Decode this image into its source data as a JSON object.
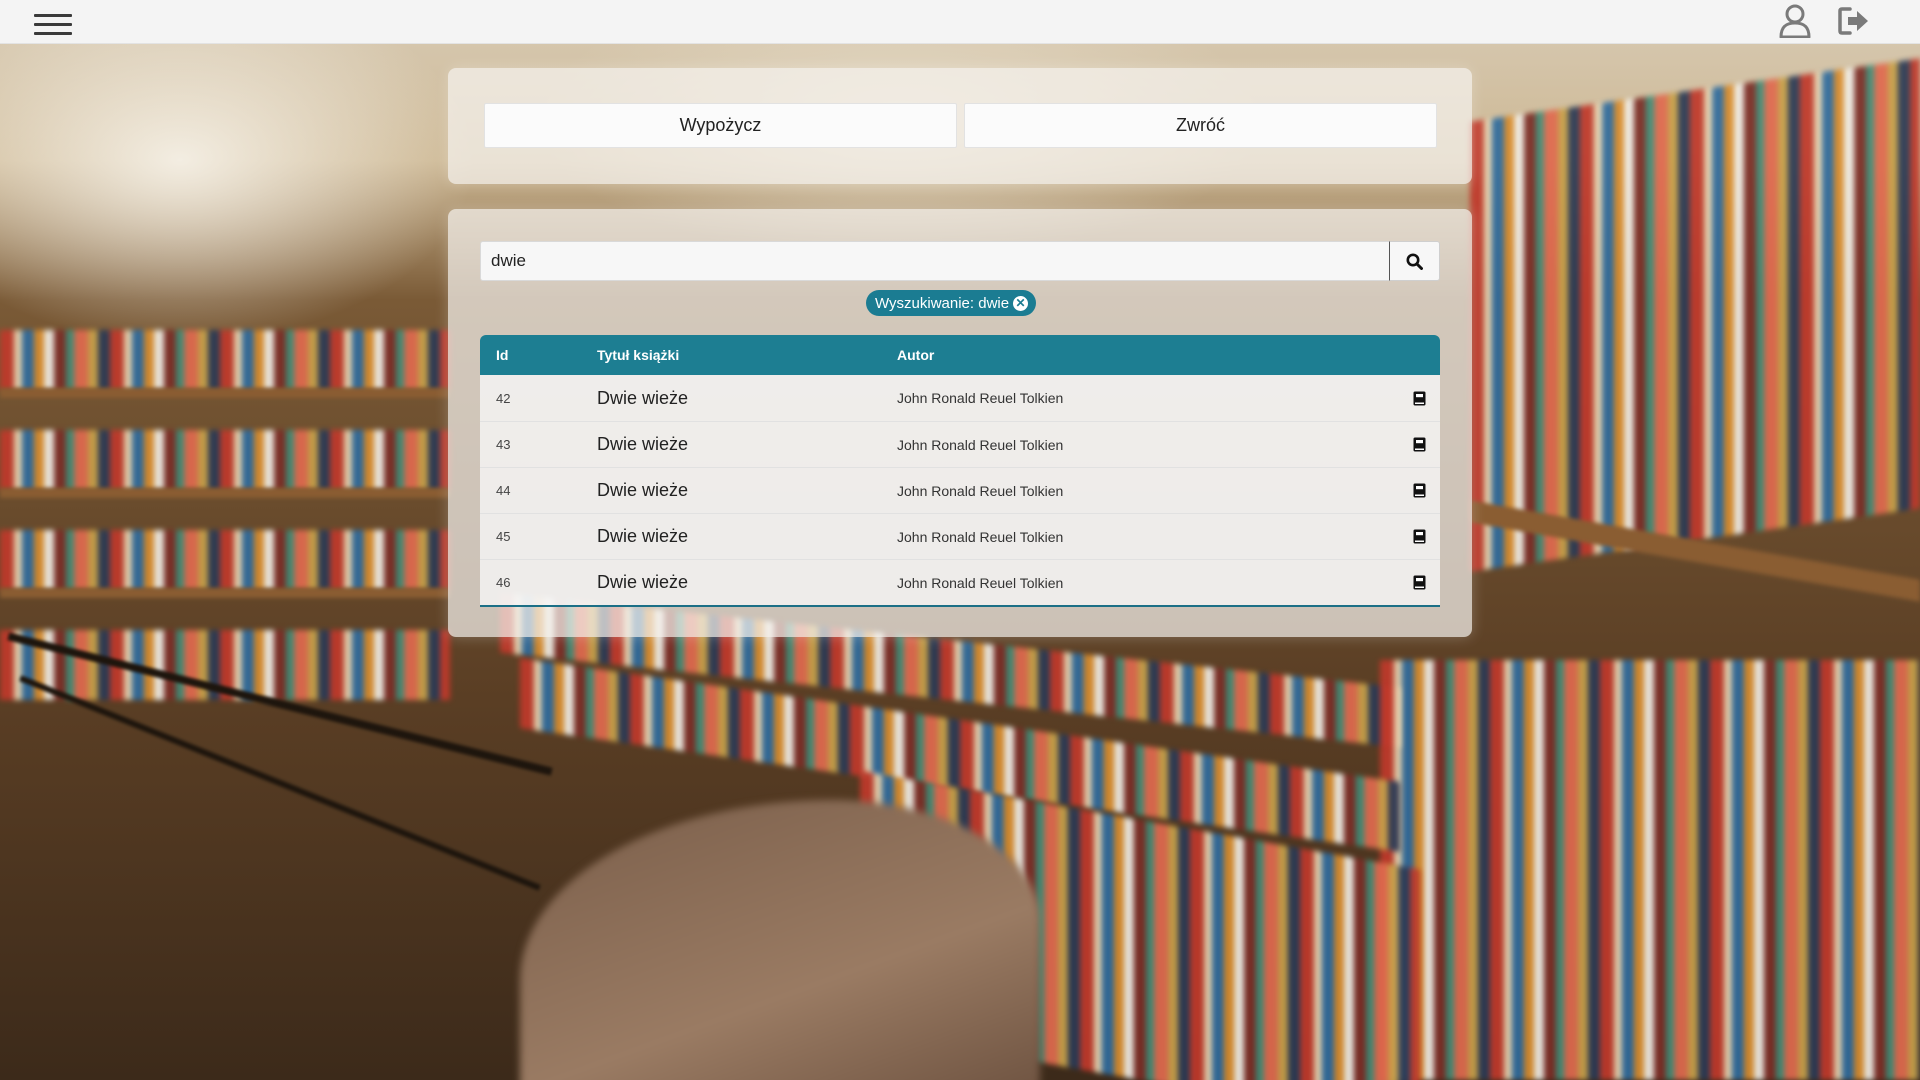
{
  "topbar": {
    "menu_icon": "hamburger-menu-icon",
    "user_icon": "user-icon",
    "logout_icon": "logout-icon"
  },
  "actions": {
    "borrow_label": "Wypożycz",
    "return_label": "Zwróć"
  },
  "search": {
    "value": "dwie",
    "button_icon": "search-icon",
    "filter_chip_label": "Wyszukiwanie: dwie",
    "filter_chip_close_icon": "close-circle-icon"
  },
  "table": {
    "headers": {
      "id": "Id",
      "title": "Tytuł książki",
      "author": "Autor"
    },
    "row_action_icon": "book-details-icon",
    "rows": [
      {
        "id": "42",
        "title": "Dwie wieże",
        "author": "John Ronald Reuel Tolkien"
      },
      {
        "id": "43",
        "title": "Dwie wieże",
        "author": "John Ronald Reuel Tolkien"
      },
      {
        "id": "44",
        "title": "Dwie wieże",
        "author": "John Ronald Reuel Tolkien"
      },
      {
        "id": "45",
        "title": "Dwie wieże",
        "author": "John Ronald Reuel Tolkien"
      },
      {
        "id": "46",
        "title": "Dwie wieże",
        "author": "John Ronald Reuel Tolkien"
      }
    ]
  },
  "colors": {
    "accent": "#1d7e92",
    "topbar": "#f4f4f4"
  }
}
